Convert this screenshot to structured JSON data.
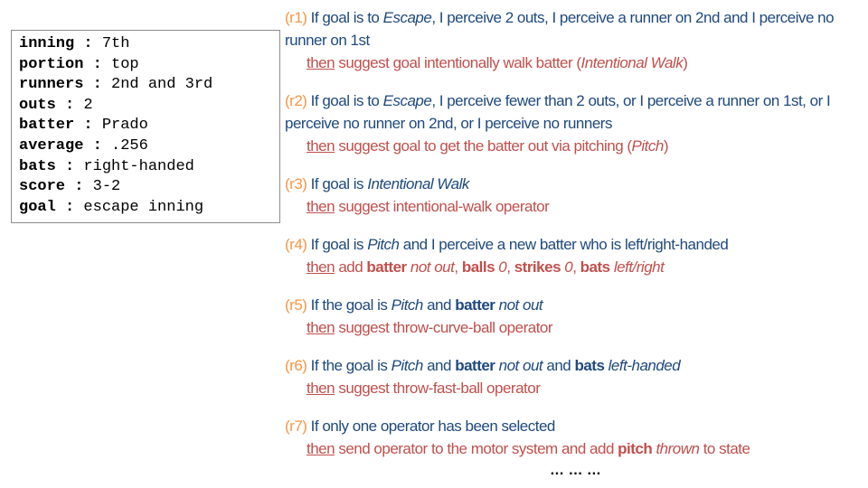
{
  "state": [
    {
      "key": "inning",
      "sep": " : ",
      "value": "7th"
    },
    {
      "key": "portion",
      "sep": " : ",
      "value": "top"
    },
    {
      "key": "runners",
      "sep": " : ",
      "value": "2nd and 3rd"
    },
    {
      "key": "outs",
      "sep": " : ",
      "value": "2"
    },
    {
      "key": "batter",
      "sep": " : ",
      "value": "Prado"
    },
    {
      "key": "average",
      "sep": " : ",
      "value": ".256"
    },
    {
      "key": "bats",
      "sep": " : ",
      "value": "right-handed"
    },
    {
      "key": "score",
      "sep": " : ",
      "value": "3-2"
    },
    {
      "key": "goal",
      "sep": " : ",
      "value": "escape inning"
    }
  ],
  "rules": {
    "r1": {
      "id": "(r1)",
      "if_a": " If goal is to ",
      "if_b": "Escape",
      "if_c": ", I perceive 2 outs, I perceive a runner on 2nd and I perceive no runner on 1st",
      "then": "then",
      "then_a": " suggest goal intentionally walk batter (",
      "then_b": "Intentional Walk",
      "then_c": ")"
    },
    "r2": {
      "id": "(r2)",
      "if_a": " If goal is to ",
      "if_b": "Escape",
      "if_c": ", I perceive fewer than 2 outs, or I perceive a runner on 1st, or I perceive no runner on 2nd, or I perceive no runners",
      "then": "then",
      "then_a": " suggest goal to get the batter out via pitching (",
      "then_b": "Pitch",
      "then_c": ")"
    },
    "r3": {
      "id": "(r3)",
      "if_a": " If goal is ",
      "if_b": "Intentional Walk",
      "then": "then",
      "then_a": " suggest intentional-walk operator"
    },
    "r4": {
      "id": "(r4)",
      "if_a": " If goal is ",
      "if_b": "Pitch",
      "if_c": " and I perceive a new batter who is left/right-handed",
      "then": "then",
      "then_a": " add ",
      "t_batter": "batter",
      "t_notout": " not out",
      "t_c1": ", ",
      "t_balls": "balls",
      "t_zero1": " 0",
      "t_c2": ", ",
      "t_strikes": "strikes",
      "t_zero2": " 0",
      "t_c3": ", ",
      "t_bats": "bats",
      "t_lr": " left/right"
    },
    "r5": {
      "id": "(r5)",
      "if_a": " If the goal is ",
      "if_b": "Pitch",
      "if_c": " and ",
      "if_d": "batter",
      "if_e": " not out",
      "then": "then",
      "then_a": " suggest throw-curve-ball operator"
    },
    "r6": {
      "id": "(r6)",
      "if_a": " If the goal is ",
      "if_b": "Pitch",
      "if_c": " and ",
      "if_d": "batter",
      "if_e": " not out",
      "if_f": " and ",
      "if_g": "bats",
      "if_h": " left-handed",
      "then": "then",
      "then_a": " suggest throw-fast-ball operator"
    },
    "r7": {
      "id": "(r7)",
      "if_a": " If only one operator has been selected",
      "then": "then",
      "then_a": " send operator to the motor system and add ",
      "then_b": "pitch",
      "then_c": " thrown",
      "then_d": " to state"
    }
  },
  "ellipsis": "… … …"
}
